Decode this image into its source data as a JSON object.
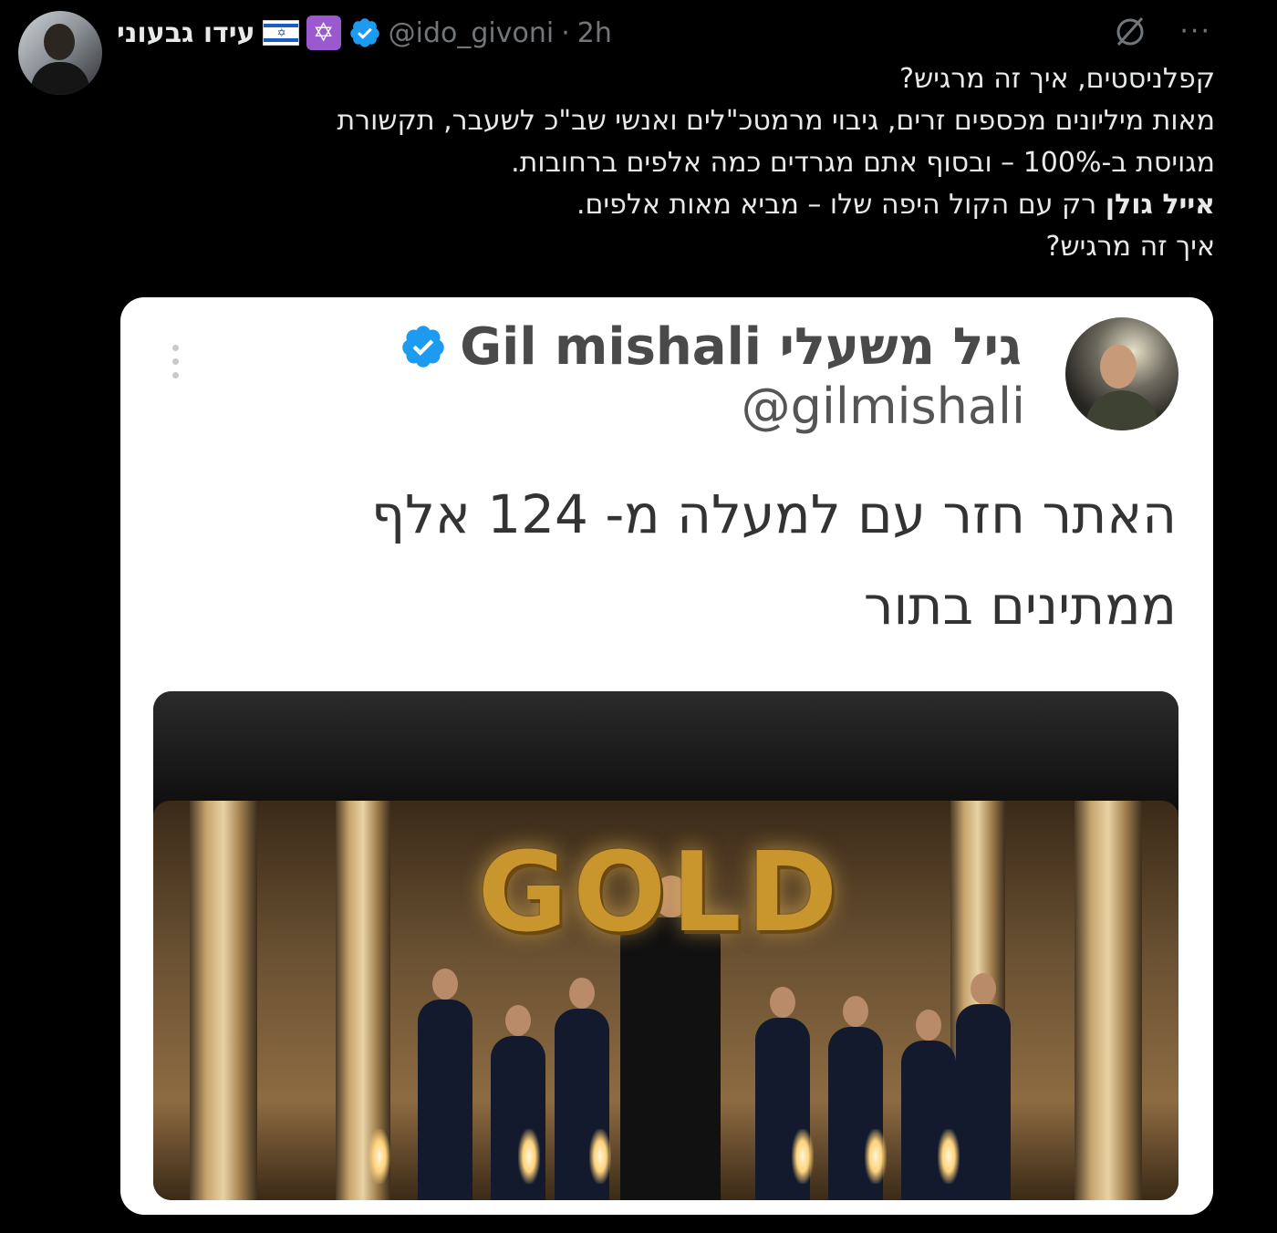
{
  "post": {
    "display_name": "עידו גבעוני",
    "handle": "@ido_givoni",
    "separator": "·",
    "time": "2h",
    "more_label": "···",
    "text_lines": [
      "קפלניסטים, איך זה מרגיש?",
      "מאות מיליונים מכספים זרים, גיבוי מרמטכ\"לים ואנשי שב\"כ לשעבר, תקשורת",
      "מגויסת ב-100% – ובסוף אתם מגרדים כמה אלפים ברחובות."
    ],
    "bold_name": "אייל גולן",
    "line4_rest": " רק עם הקול היפה שלו – מביא מאות אלפים.",
    "last_line": "איך זה מרגיש?"
  },
  "quoted": {
    "display_name": "גיל משעלי Gil mishali",
    "handle": "@gilmishali",
    "text_lines": [
      "האתר חזר עם למעלה מ- 124 אלף",
      "ממתינים בתור"
    ],
    "image_title": "GOLD"
  },
  "icons": {
    "verified": "verified-badge-icon",
    "flag": "israel-flag-icon",
    "star": "star-of-david-icon",
    "grok": "grok-icon",
    "more": "more-icon"
  },
  "colors": {
    "background": "#000000",
    "text": "#e7e9ea",
    "muted": "#71767b",
    "verified": "#1d9bf0",
    "card": "#ffffff"
  }
}
